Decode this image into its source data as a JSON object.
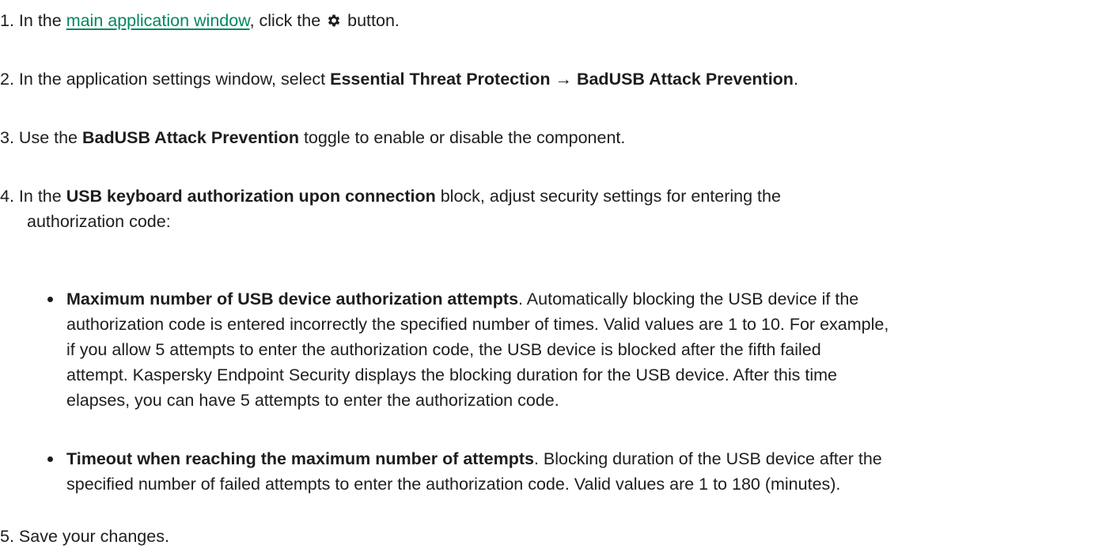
{
  "steps": [
    {
      "num": "1.",
      "pre": " In the ",
      "link": "main application window",
      "mid": ", click the ",
      "icon": "gear-icon",
      "post": " button."
    },
    {
      "num": "2.",
      "pre": " In the application settings window, select ",
      "bold": "Essential Threat Protection → BadUSB Attack Prevention",
      "post": "."
    },
    {
      "num": "3.",
      "pre": " Use the ",
      "bold": "BadUSB Attack Prevention",
      "post": " toggle to enable or disable the component."
    },
    {
      "num": "4.",
      "pre": " In the ",
      "bold": "USB keyboard authorization upon connection",
      "post": " block, adjust security settings for entering the",
      "cont": "authorization code:",
      "bullets": [
        {
          "bold": "Maximum number of USB device authorization attempts",
          "lines": [
            ". Automatically blocking the USB device if the",
            "authorization code is entered incorrectly the specified number of times. Valid values are 1 to 10. For example,",
            "if you allow 5 attempts to enter the authorization code, the USB device is blocked after the fifth failed",
            "attempt. Kaspersky Endpoint Security displays the blocking duration for the USB device. After this time",
            "elapses, you can have 5 attempts to enter the authorization code."
          ]
        },
        {
          "bold": "Timeout when reaching the maximum number of attempts",
          "lines": [
            ". Blocking duration of the USB device after the",
            "specified number of failed attempts to enter the authorization code. Valid values are 1 to 180 (minutes)."
          ]
        }
      ]
    },
    {
      "num": "5.",
      "pre": " Save your changes."
    }
  ]
}
